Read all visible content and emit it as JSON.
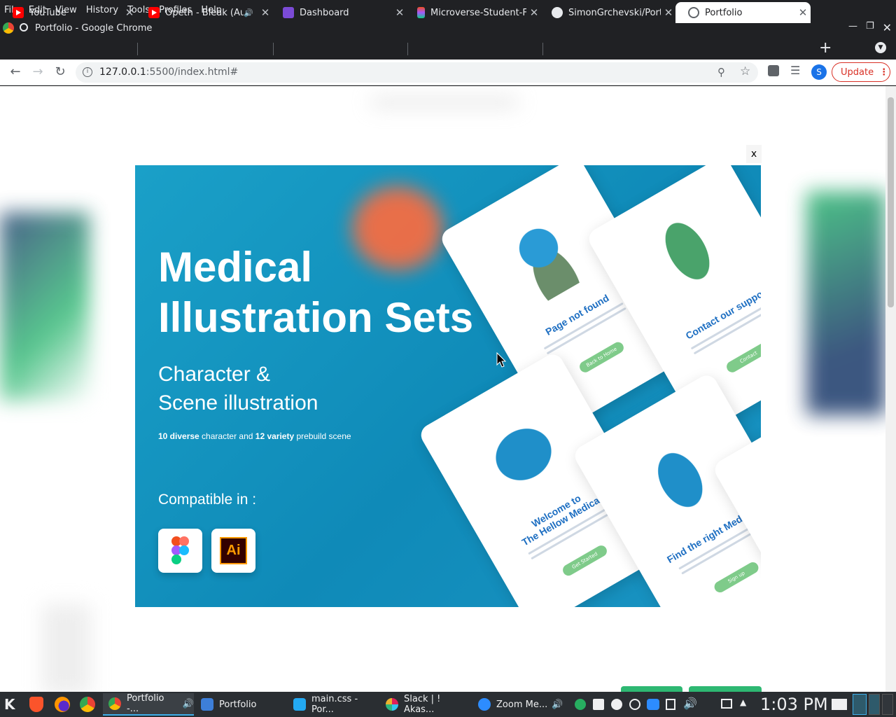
{
  "menubar": {
    "items": [
      "File",
      "Edit",
      "View",
      "History",
      "Tools",
      "Profiles",
      "Help"
    ]
  },
  "window": {
    "title": "Portfolio - Google Chrome"
  },
  "tabs": [
    {
      "label": "YouTube"
    },
    {
      "label": "Opeth - Bleak (Au"
    },
    {
      "label": "Dashboard"
    },
    {
      "label": "Microverse-Student-F"
    },
    {
      "label": "SimonGrchevski/Port"
    },
    {
      "label": "Portfolio"
    }
  ],
  "toolbar": {
    "url_host": "127.0.0.1",
    "url_rest": ":5500/index.html#",
    "profile_initial": "S",
    "update_label": "Update"
  },
  "modal": {
    "close_label": "x",
    "title_line1": "Medical",
    "title_line2": "Illustration Sets",
    "subtitle_line1": "Character &",
    "subtitle_line2": "Scene illustration",
    "desc_bold1": "10 diverse",
    "desc_mid": " character and ",
    "desc_bold2": "12 variety",
    "desc_end": " prebuild scene",
    "compatible": "Compatible in :",
    "ai_label": "Ai",
    "cards": [
      {
        "title": "Page not found",
        "button": "Back to Home"
      },
      {
        "title": "Contact our suppo",
        "button": "Contact"
      },
      {
        "title": "Welcome to\nThe Hellow Medical",
        "button": "Get Started"
      },
      {
        "title": "Find the right Medicin",
        "button": "Sign up"
      }
    ]
  },
  "taskbar": {
    "tasks": [
      {
        "label": "Portfolio -..."
      },
      {
        "label": "Portfolio"
      },
      {
        "label": "main.css - Por..."
      },
      {
        "label": "Slack | ! Akas..."
      },
      {
        "label": "Zoom Me..."
      }
    ],
    "clock": "1:03 PM"
  },
  "colors": {
    "modal_bg": "#1aa0c8",
    "accent_update": "#d93025",
    "card_title": "#1e6fc2",
    "card_button": "#7fcb8a"
  }
}
